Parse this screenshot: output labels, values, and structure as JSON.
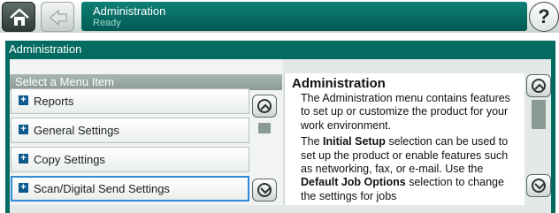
{
  "header": {
    "title": "Administration",
    "status": "Ready",
    "help_label": "?"
  },
  "section_title": "Administration",
  "menu": {
    "header": "Select a Menu Item",
    "items": [
      {
        "label": "Reports"
      },
      {
        "label": "General Settings"
      },
      {
        "label": "Copy Settings"
      },
      {
        "label": "Scan/Digital Send Settings",
        "selected": true
      }
    ]
  },
  "info": {
    "title": "Administration",
    "para1": "The Administration menu contains features to set up or customize the product for your work environment.",
    "para2_a": "The ",
    "para2_b": "Initial Setup",
    "para2_c": " selection can be used to set up the product or enable features such as networking, fax, or e-mail. Use the ",
    "para2_d": "Default Job Options",
    "para2_e": " selection to change the settings for jobs"
  },
  "colors": {
    "accent": "#036b60",
    "title_bar": "#0f8076",
    "selection_border": "#2f8bd6"
  },
  "icons": [
    "home-icon",
    "back-arrow-icon",
    "help-icon",
    "plus-icon",
    "scroll-up-icon",
    "scroll-down-icon"
  ]
}
